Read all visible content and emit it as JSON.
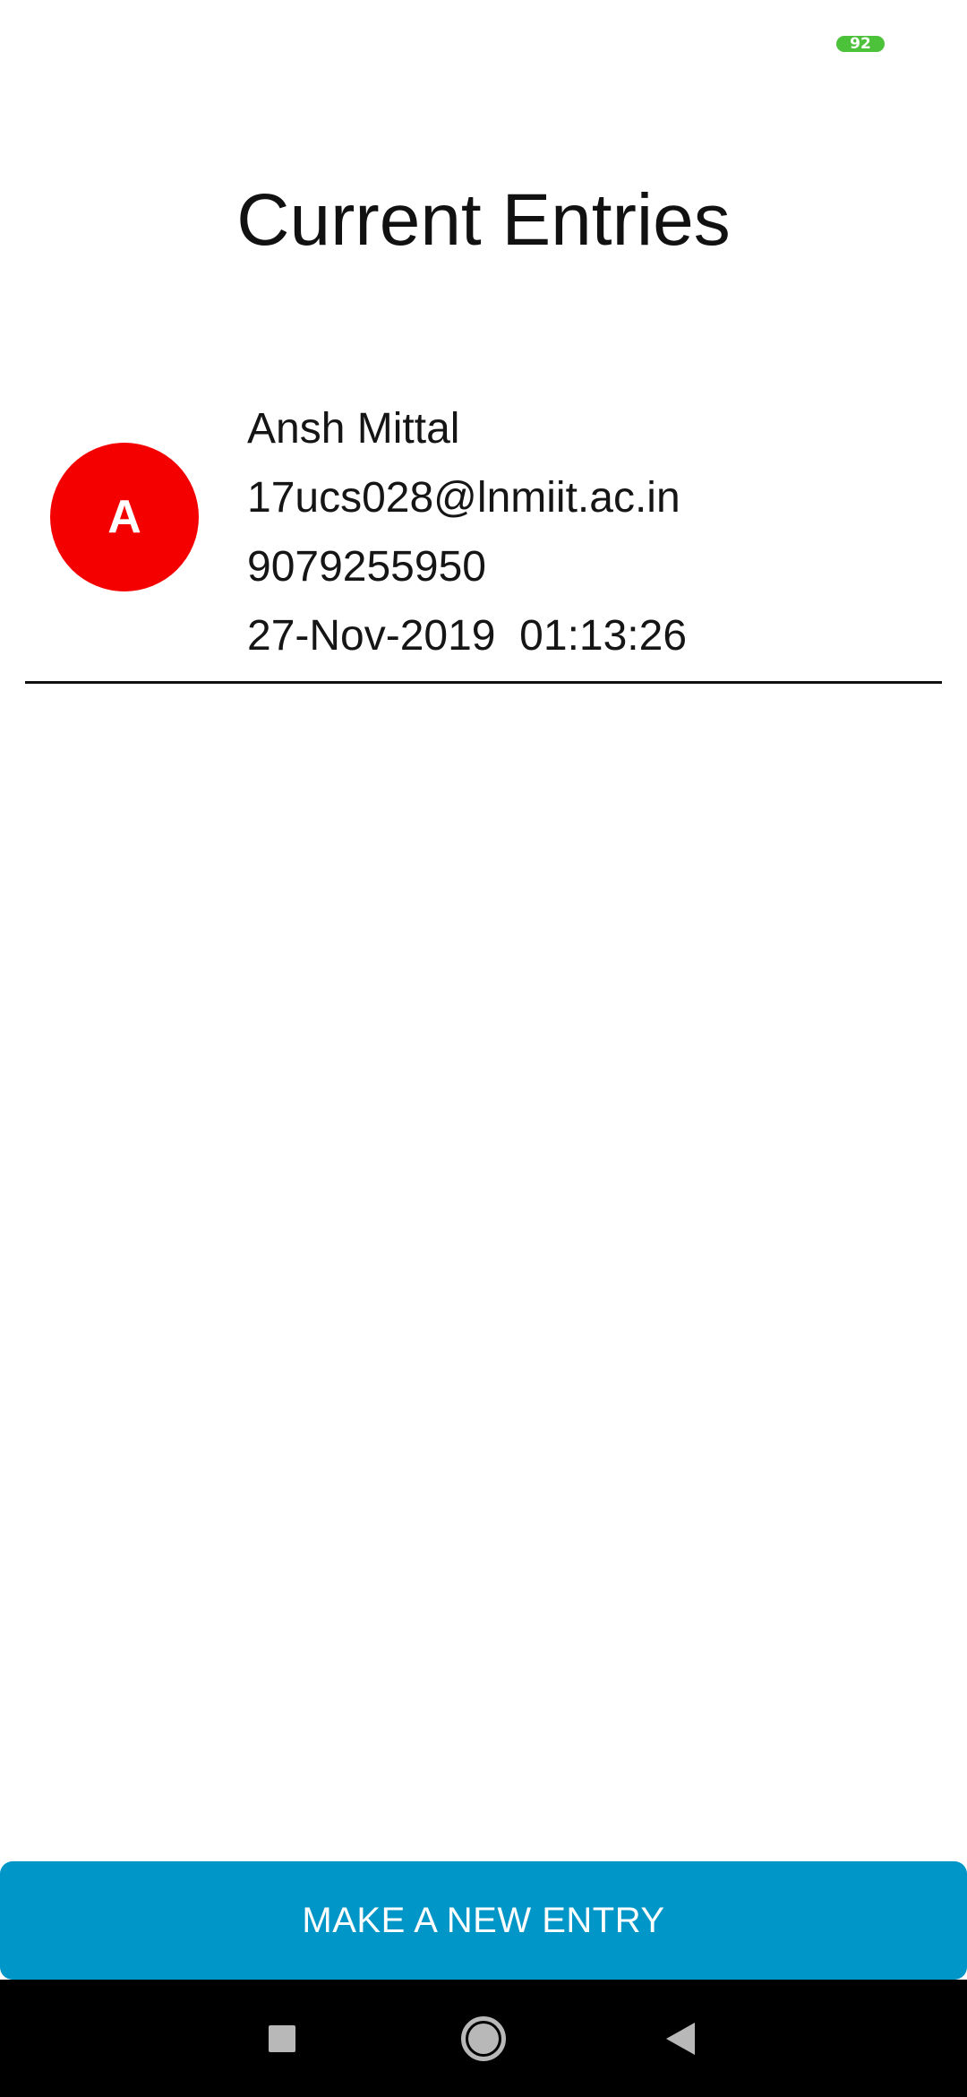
{
  "status_bar": {
    "battery_level": "92",
    "battery_color": "#4cc13a"
  },
  "page": {
    "title": "Current Entries"
  },
  "entries": [
    {
      "initial": "A",
      "avatar_color": "#f40000",
      "name": "Ansh Mittal",
      "email": "17ucs028@lnmiit.ac.in",
      "phone": "9079255950",
      "datetime": "27-Nov-2019  01:13:26"
    }
  ],
  "actions": {
    "new_entry_label": "MAKE A NEW ENTRY",
    "button_color": "#0096c7"
  },
  "navigation": {
    "recents_icon": "square-icon",
    "home_icon": "circle-home-icon",
    "back_icon": "triangle-back-icon"
  }
}
